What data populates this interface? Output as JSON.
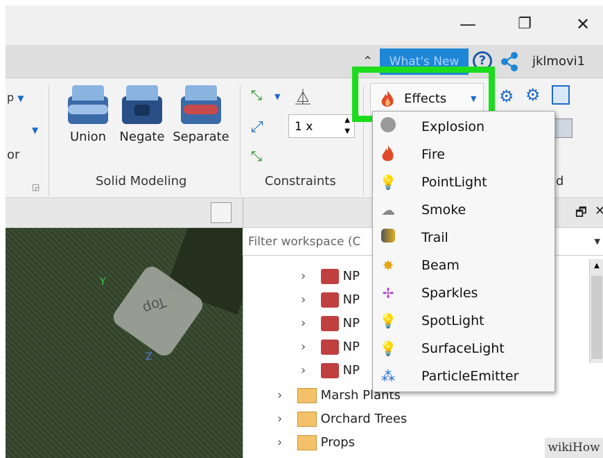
{
  "window": {
    "minimize": "—",
    "restore": "❐",
    "close": "✕"
  },
  "tabrow": {
    "whats_new": "What's New",
    "help_icon": "?",
    "user": "jklmovi1"
  },
  "ribbon": {
    "partial_left_1": "p",
    "partial_left_2": "or",
    "solid_modeling": {
      "union": "Union",
      "negate": "Negate",
      "separate": "Separate",
      "label": "Solid Modeling"
    },
    "constraints": {
      "scale_value": "1 x",
      "label": "Constraints"
    },
    "partial_label_right": "d",
    "effects_label": "Effects"
  },
  "effects_menu": {
    "items": [
      {
        "label": "Explosion",
        "icon": "explosion-icon"
      },
      {
        "label": "Fire",
        "icon": "fire-icon"
      },
      {
        "label": "PointLight",
        "icon": "bulb-icon"
      },
      {
        "label": "Smoke",
        "icon": "cloud-icon"
      },
      {
        "label": "Trail",
        "icon": "trail-icon"
      },
      {
        "label": "Beam",
        "icon": "beam-icon"
      },
      {
        "label": "Sparkles",
        "icon": "sparkles-icon"
      },
      {
        "label": "SpotLight",
        "icon": "bulb-icon"
      },
      {
        "label": "SurfaceLight",
        "icon": "bulb-icon"
      },
      {
        "label": "ParticleEmitter",
        "icon": "particle-icon"
      }
    ]
  },
  "viewport": {
    "part_label": "Top",
    "axis_y": "Y",
    "axis_z": "Z"
  },
  "explorer": {
    "filter_placeholder": "Filter workspace (C",
    "npc_rows": [
      "NP",
      "NP",
      "NP",
      "NP",
      "NP"
    ],
    "folders": [
      "Marsh Plants",
      "Orchard Trees",
      "Props"
    ]
  },
  "watermark": {
    "text": "wikiHow"
  }
}
